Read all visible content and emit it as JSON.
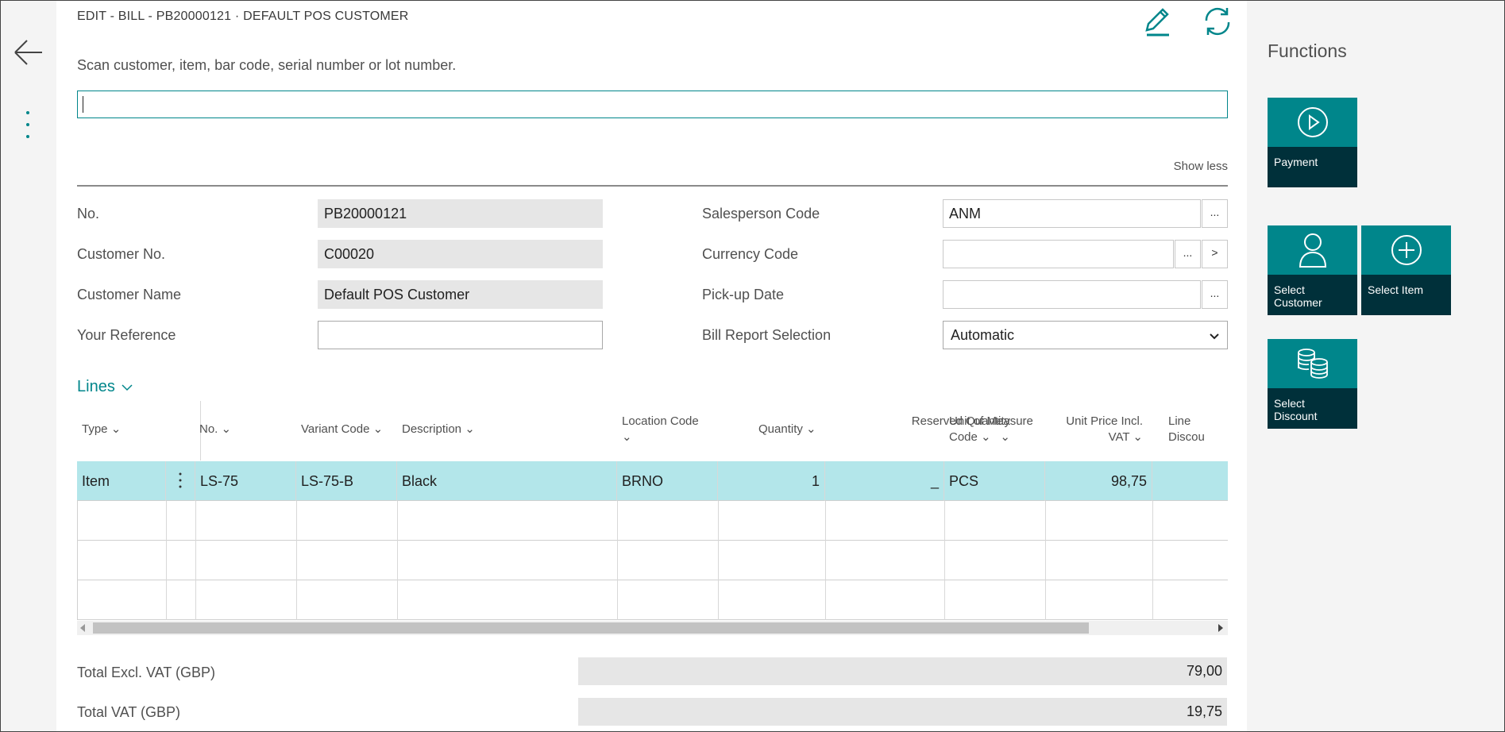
{
  "page": {
    "title": "EDIT - BILL - PB20000121 · DEFAULT POS CUSTOMER",
    "scan_label": "Scan customer, item, bar code, serial number or lot number.",
    "scan_value": "",
    "show_less": "Show less"
  },
  "fields": {
    "no": {
      "label": "No.",
      "value": "PB20000121"
    },
    "customer_no": {
      "label": "Customer No.",
      "value": "C00020"
    },
    "customer_name": {
      "label": "Customer Name",
      "value": "Default POS Customer"
    },
    "your_reference": {
      "label": "Your Reference",
      "value": ""
    },
    "salesperson_code": {
      "label": "Salesperson Code",
      "value": "ANM"
    },
    "currency_code": {
      "label": "Currency Code",
      "value": ""
    },
    "pickup_date": {
      "label": "Pick-up Date",
      "value": ""
    },
    "bill_report_selection": {
      "label": "Bill Report Selection",
      "value": "Automatic"
    },
    "ellipsis": "...",
    "next": ">"
  },
  "lines": {
    "title": "Lines",
    "columns": {
      "type": "Type",
      "no": "No.",
      "variant_code": "Variant Code",
      "description": "Description",
      "location_code": "Location Code",
      "quantity": "Quantity",
      "reserved_quantity": "Reserved Quantity",
      "unit_of_measure_code_1": "Unit of Measure",
      "unit_of_measure_code_2": "Code",
      "unit_price_1": "Unit Price Incl.",
      "unit_price_2": "VAT",
      "line_discount": "Line Discou"
    },
    "rows": [
      {
        "type": "Item",
        "no": "LS-75",
        "variant_code": "LS-75-B",
        "description": "Black",
        "location_code": "BRNO",
        "quantity": "1",
        "reserved_quantity": "_",
        "unit_of_measure_code": "PCS",
        "unit_price": "98,75",
        "line_discount": ""
      }
    ]
  },
  "totals": {
    "excl_vat": {
      "label": "Total Excl. VAT (GBP)",
      "value": "79,00"
    },
    "vat": {
      "label": "Total VAT (GBP)",
      "value": "19,75"
    }
  },
  "functions": {
    "title": "Functions",
    "tiles": {
      "payment": "Payment",
      "select_customer": "Select Customer",
      "select_item": "Select Item",
      "select_discount": "Select Discount"
    }
  },
  "icons": {
    "back": "back-arrow-icon",
    "more": "more-vertical-icon",
    "edit": "pencil-icon",
    "refresh": "refresh-icon",
    "payment": "play-circle-icon",
    "customer": "person-icon",
    "item": "plus-circle-icon",
    "discount": "coins-icon"
  },
  "colors": {
    "accent": "#00868b",
    "tile_top": "#00868b",
    "tile_bottom": "#00303a",
    "selected_row": "#b3e6ea",
    "readonly_field": "#e6e6e6"
  }
}
